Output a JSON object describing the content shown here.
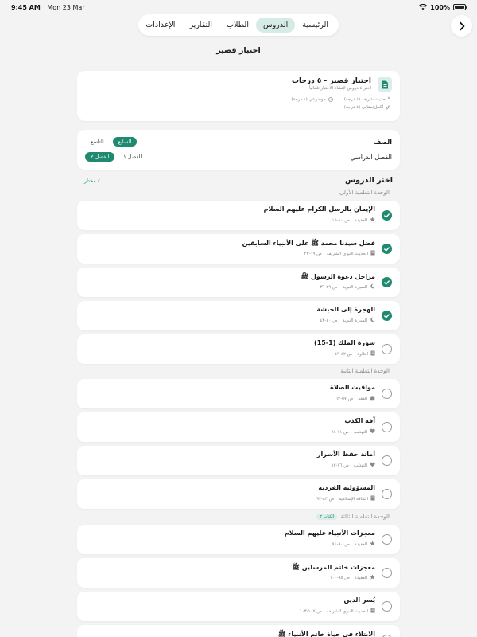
{
  "status_bar": {
    "time": "9:45 AM",
    "date": "Mon 23 Mar",
    "battery": "100%"
  },
  "nav": {
    "tabs": [
      {
        "label": "الرئيسية",
        "active": false
      },
      {
        "label": "الدروس",
        "active": true
      },
      {
        "label": "الطلاب",
        "active": false
      },
      {
        "label": "التقارير",
        "active": false
      },
      {
        "label": "الإعدادات",
        "active": false
      }
    ]
  },
  "page": {
    "title": "اختبار قصير"
  },
  "quiz": {
    "title": "اختبار قصير - ٥ درجات",
    "subtitle": "اختر ٤ دروس لإنشاء الاختبار تلقائياً",
    "meta1": "حديث شريف (١ درجة)",
    "meta2": "موضوعي (١ درجة)",
    "meta3": "أكمل/مقالي (٤ درجة)"
  },
  "grade": {
    "class_label": "الصف",
    "class_options": [
      {
        "label": "السابع",
        "selected": true
      },
      {
        "label": "التاسع",
        "selected": false
      }
    ],
    "term_label": "الفصل الدراسي",
    "term_options": [
      {
        "label": "الفصل ١",
        "selected": false
      },
      {
        "label": "الفصل ٢",
        "selected": true
      }
    ]
  },
  "lessons_section": {
    "title": "اختر الدروس",
    "selected_count": "٤ مختار"
  },
  "units": [
    {
      "title": "الوحدة التعلمية الأولى",
      "badge": ""
    },
    {
      "title": "الوحدة التعلمية الثانية",
      "badge": ""
    },
    {
      "title": "الوحدة التعلمية الثالثة",
      "badge": "الكتاب ٢"
    }
  ],
  "lessons": [
    {
      "title": "الإيمان بالرسل الكرام عليهم السلام",
      "category": "العقيدة",
      "pages": "ص ١٠-١٥",
      "icon": "star-icon",
      "checked": true
    },
    {
      "title": "فضل سيدنا محمد ﷺ على الأنبياء السابقين",
      "category": "الحديث النبوي الشريف",
      "pages": "ص ١٩-٢٣",
      "icon": "book-icon",
      "checked": true
    },
    {
      "title": "مراحل دعوة الرسول ﷺ",
      "category": "السيرة النبوية",
      "pages": "ص ٢٩-٣٦",
      "icon": "moon-icon",
      "checked": true
    },
    {
      "title": "الهجرة إلى الحبشة",
      "category": "السيرة النبوية",
      "pages": "ص ٤٠-٤٣",
      "icon": "moon-icon",
      "checked": true
    },
    {
      "title": "سورة الملك (1-15)",
      "category": "التلاوة",
      "pages": "ص ٤٢-٤٩",
      "icon": "book-icon",
      "checked": false
    },
    {
      "title": "مواقيت الصلاة",
      "category": "الفقه",
      "pages": "ص ٥٧-٦٣",
      "icon": "mosque-icon",
      "checked": false
    },
    {
      "title": "آفة الكذب",
      "category": "التهذيب",
      "pages": "ص ٧١-٧٨",
      "icon": "heart-icon",
      "checked": false
    },
    {
      "title": "أمانة حفظ الأسرار",
      "category": "التهذيب",
      "pages": "ص ٧٦-٨٢",
      "icon": "heart-icon",
      "checked": false
    },
    {
      "title": "المسؤولية الفردية",
      "category": "الثقافة الإسلامية",
      "pages": "ص ٨٣-٩٣",
      "icon": "book-icon",
      "checked": false
    },
    {
      "title": "معجزات الأنبياء عليهم السلام",
      "category": "العقيدة",
      "pages": "ص ٩٠-٩٤",
      "icon": "star-icon",
      "checked": false
    },
    {
      "title": "معجزات خاتم المرسلين ﷺ",
      "category": "العقيدة",
      "pages": "ص ٩٥-١٠٠",
      "icon": "star-icon",
      "checked": false
    },
    {
      "title": "يُسر الدين",
      "category": "الحديث النبوي الشريف",
      "pages": "ص ١٠٧-١٠٣",
      "icon": "book-icon",
      "checked": false
    },
    {
      "title": "الابتلاء في حياة خاتم الأنبياء ﷺ",
      "category": "",
      "pages": "",
      "icon": "",
      "checked": false
    }
  ]
}
